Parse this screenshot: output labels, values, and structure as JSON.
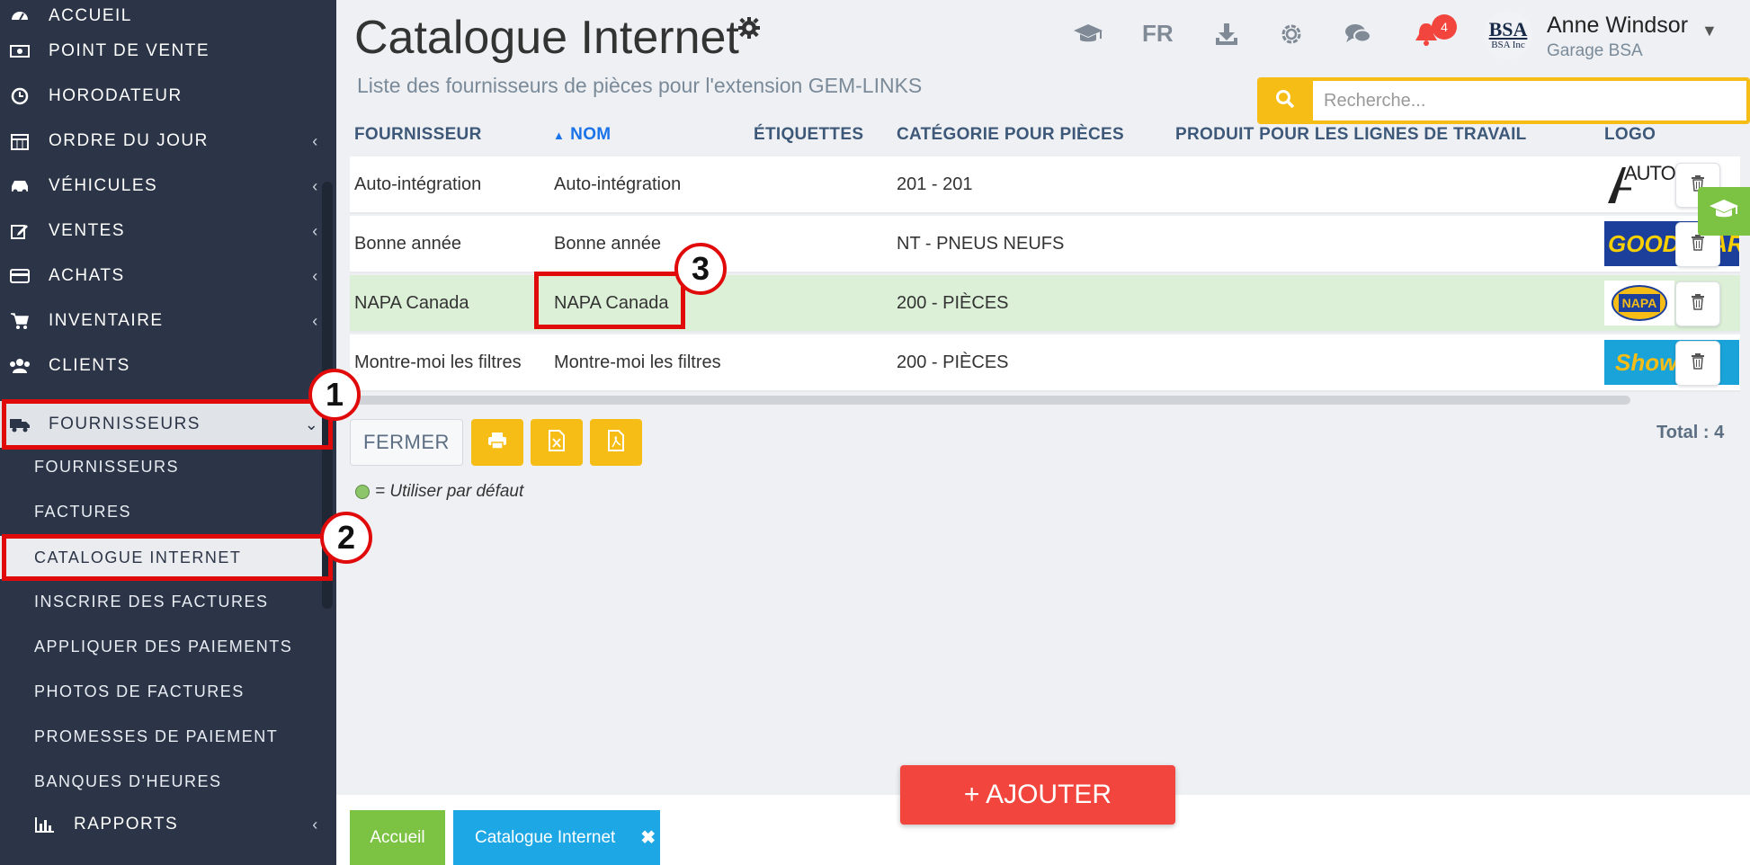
{
  "sidebar": {
    "items": [
      {
        "label": "ACCUEIL",
        "icon": "dashboard-icon"
      },
      {
        "label": "POINT DE VENTE",
        "icon": "cash-icon"
      },
      {
        "label": "HORODATEUR",
        "icon": "clock-icon"
      },
      {
        "label": "ORDRE DU JOUR",
        "icon": "calendar-icon",
        "chevron": "‹"
      },
      {
        "label": "VÉHICULES",
        "icon": "car-icon",
        "chevron": "‹"
      },
      {
        "label": "VENTES",
        "icon": "edit-icon",
        "chevron": "‹"
      },
      {
        "label": "ACHATS",
        "icon": "credit-card-icon",
        "chevron": "‹"
      },
      {
        "label": "INVENTAIRE",
        "icon": "cart-icon",
        "chevron": "‹"
      },
      {
        "label": "CLIENTS",
        "icon": "users-icon"
      },
      {
        "label": "FOURNISSEURS",
        "icon": "truck-icon",
        "chevron": "⌄"
      }
    ],
    "sub_items": [
      "FOURNISSEURS",
      "FACTURES",
      "CATALOGUE INTERNET",
      "INSCRIRE DES FACTURES",
      "APPLIQUER DES PAIEMENTS",
      "PHOTOS DE FACTURES",
      "PROMESSES DE PAIEMENT",
      "BANQUES D'HEURES"
    ],
    "rapports": {
      "label": "RAPPORTS",
      "icon": "bar-chart-icon",
      "chevron": "‹"
    },
    "active_sub": "CATALOGUE INTERNET"
  },
  "header": {
    "title": "Catalogue Internet",
    "subtitle": "Liste des fournisseurs de pièces pour l'extension GEM-LINKS",
    "lang": "FR",
    "notification_count": "4",
    "user_name": "Anne Windsor",
    "user_org": "Garage BSA",
    "avatar_text": "BSA",
    "avatar_subtext": "BSA Inc"
  },
  "search": {
    "placeholder": "Recherche..."
  },
  "table": {
    "columns": [
      "FOURNISSEUR",
      "NOM",
      "ÉTIQUETTES",
      "CATÉGORIE POUR PIÈCES",
      "PRODUIT POUR LES LIGNES DE TRAVAIL",
      "LOGO"
    ],
    "sorted_column": "NOM",
    "sort_indicator": "▲",
    "rows": [
      {
        "fournisseur": "Auto-intégration",
        "nom": "Auto-intégration",
        "etiquettes": "",
        "categorie": "201 - 201",
        "produit": "",
        "logo_text": "AUTO INT"
      },
      {
        "fournisseur": "Bonne année",
        "nom": "Bonne année",
        "etiquettes": "",
        "categorie": "NT - PNEUS NEUFS",
        "produit": "",
        "logo_text": "GOODYEAR"
      },
      {
        "fournisseur": "NAPA Canada",
        "nom": "NAPA Canada",
        "etiquettes": "",
        "categorie": "200 - PIÈCES",
        "produit": "",
        "logo_text": "NAPA",
        "selected": true
      },
      {
        "fournisseur": "Montre-moi les filtres",
        "nom": "Montre-moi les filtres",
        "etiquettes": "",
        "categorie": "200 - PIÈCES",
        "produit": "",
        "logo_text": "ShowMe"
      }
    ]
  },
  "actions": {
    "close_label": "FERMER",
    "total_label": "Total : 4"
  },
  "legend": {
    "text": "= Utiliser par défaut"
  },
  "bottom": {
    "add_label": "+ AJOUTER",
    "tab_home": "Accueil",
    "tab_current": "Catalogue Internet",
    "tab_close": "✖"
  },
  "annotations": [
    "1",
    "2",
    "3"
  ],
  "colors": {
    "sidebar_bg": "#2c3547",
    "accent_yellow": "#f6bd16",
    "accent_red": "#f2453d",
    "accent_green": "#7cc344",
    "accent_blue": "#1ea7e5",
    "highlight_red": "#e10a0a",
    "selected_row": "#dcefd7"
  }
}
